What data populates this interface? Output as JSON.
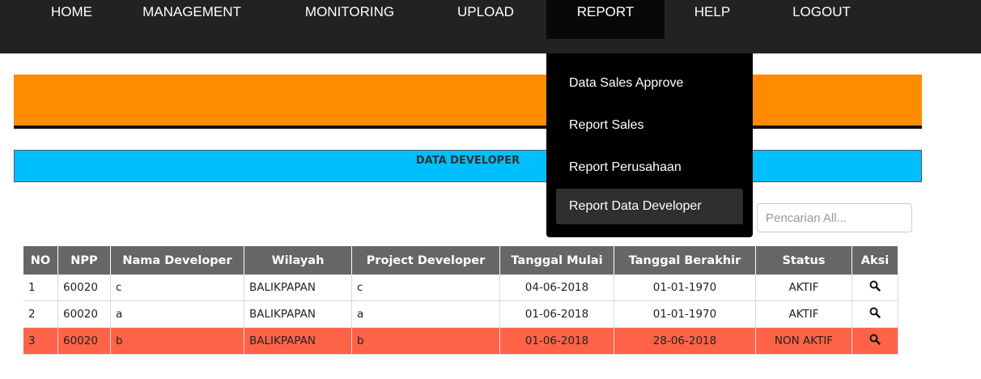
{
  "nav": {
    "items": [
      {
        "label": "HOME"
      },
      {
        "label": "MANAGEMENT"
      },
      {
        "label": "MONITORING"
      },
      {
        "label": "UPLOAD"
      },
      {
        "label": "REPORT"
      },
      {
        "label": "HELP"
      },
      {
        "label": "LOGOUT"
      }
    ],
    "active": "REPORT"
  },
  "report_menu": {
    "items": [
      {
        "label": "Data Sales Approve"
      },
      {
        "label": "Report Sales"
      },
      {
        "label": "Report Perusahaan"
      },
      {
        "label": "Report Data Developer"
      }
    ],
    "highlighted": "Report Data Developer"
  },
  "section_title": "DATA DEVELOPER",
  "search": {
    "placeholder": "Pencarian All..."
  },
  "table": {
    "headers": [
      "NO",
      "NPP",
      "Nama Developer",
      "Wilayah",
      "Project Developer",
      "Tanggal Mulai",
      "Tanggal Berakhir",
      "Status",
      "Aksi"
    ],
    "rows": [
      {
        "no": "1",
        "npp": "60020",
        "nama": "c",
        "wilayah": "BALIKPAPAN",
        "project": "c",
        "mulai": "04-06-2018",
        "berakhir": "01-01-1970",
        "status": "AKTIF"
      },
      {
        "no": "2",
        "npp": "60020",
        "nama": "a",
        "wilayah": "BALIKPAPAN",
        "project": "a",
        "mulai": "01-06-2018",
        "berakhir": "01-01-1970",
        "status": "AKTIF"
      },
      {
        "no": "3",
        "npp": "60020",
        "nama": "b",
        "wilayah": "BALIKPAPAN",
        "project": "b",
        "mulai": "01-06-2018",
        "berakhir": "28-06-2018",
        "status": "NON AKTIF"
      }
    ]
  },
  "colors": {
    "nav_bg": "#222222",
    "orange": "#FF8C00",
    "blue": "#00BFFF",
    "inactive_row": "#FF6347",
    "header_bg": "#666666"
  },
  "icons": {
    "aksi": "search-icon"
  }
}
